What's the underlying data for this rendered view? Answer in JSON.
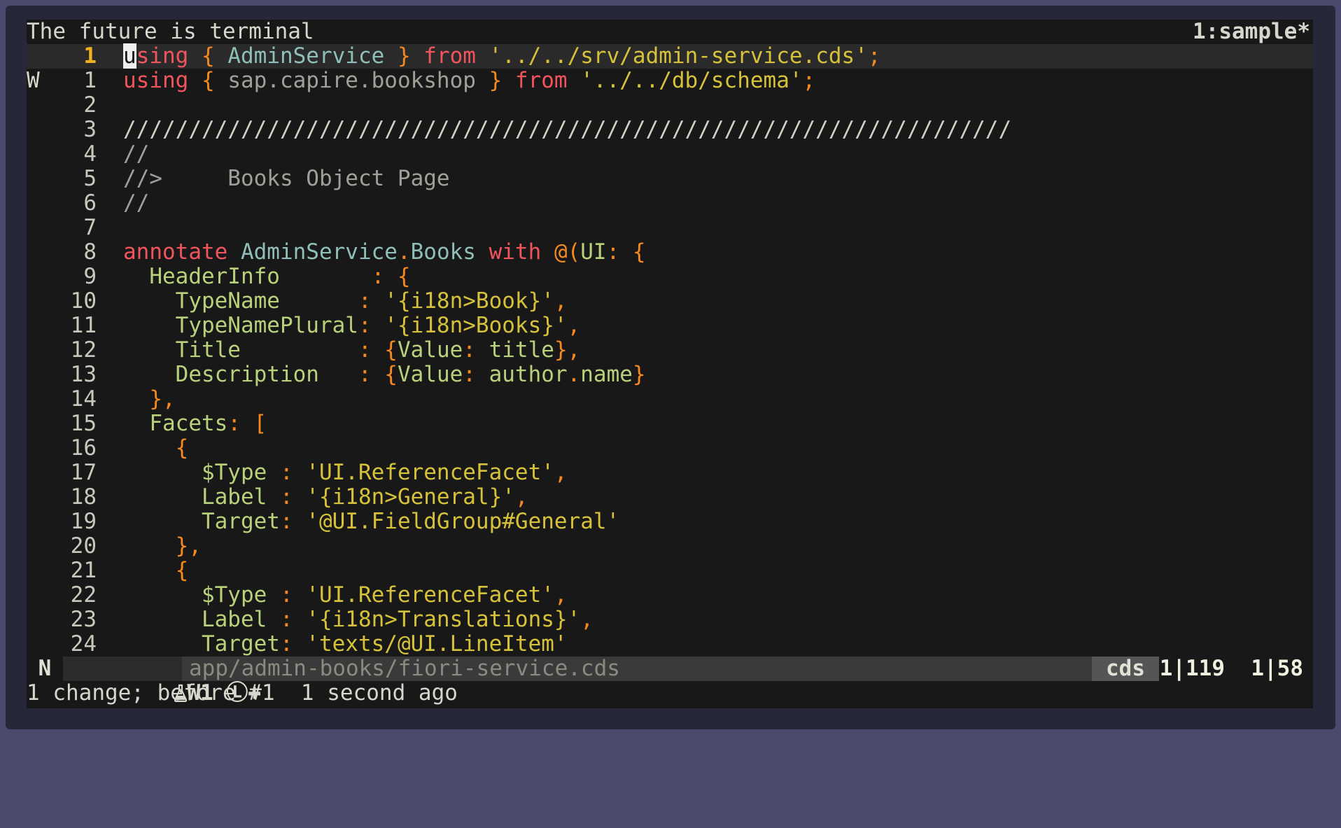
{
  "window": {
    "title": "The future is terminal",
    "session": "1:sample*"
  },
  "editor": {
    "lines": [
      {
        "mark": "",
        "num": "1",
        "current": true,
        "tokens": [
          [
            "cursor",
            "u"
          ],
          [
            "kw",
            "sing "
          ],
          [
            "pun",
            "{ "
          ],
          [
            "mod",
            "AdminService "
          ],
          [
            "pun",
            "} "
          ],
          [
            "kw",
            "from "
          ],
          [
            "str",
            "'../../srv/admin-service.cds'"
          ],
          [
            "pun",
            ";"
          ]
        ]
      },
      {
        "mark": "W",
        "num": "1",
        "tokens": [
          [
            "kw",
            "using "
          ],
          [
            "pun",
            "{ "
          ],
          [
            "cmt",
            "sap.capire.bookshop "
          ],
          [
            "pun",
            "} "
          ],
          [
            "kw",
            "from "
          ],
          [
            "str",
            "'../../db/schema'"
          ],
          [
            "pun",
            ";"
          ]
        ]
      },
      {
        "mark": "",
        "num": "2",
        "tokens": []
      },
      {
        "mark": "",
        "num": "3",
        "tokens": [
          [
            "plain",
            "////////////////////////////////////////////////////////////////////"
          ]
        ]
      },
      {
        "mark": "",
        "num": "4",
        "tokens": [
          [
            "cmt",
            "//"
          ]
        ]
      },
      {
        "mark": "",
        "num": "5",
        "tokens": [
          [
            "cmt",
            "//>     Books Object Page"
          ]
        ]
      },
      {
        "mark": "",
        "num": "6",
        "tokens": [
          [
            "cmt",
            "//"
          ]
        ]
      },
      {
        "mark": "",
        "num": "7",
        "tokens": []
      },
      {
        "mark": "",
        "num": "8",
        "tokens": [
          [
            "kw",
            "annotate "
          ],
          [
            "mod",
            "AdminService"
          ],
          [
            "pun",
            "."
          ],
          [
            "mod",
            "Books "
          ],
          [
            "kw",
            "with "
          ],
          [
            "pun",
            "@("
          ],
          [
            "prop",
            "UI"
          ],
          [
            "pun",
            ": {"
          ]
        ]
      },
      {
        "mark": "",
        "num": "9",
        "tokens": [
          [
            "plain",
            "  "
          ],
          [
            "prop",
            "HeaderInfo       "
          ],
          [
            "pun",
            ": {"
          ]
        ]
      },
      {
        "mark": "",
        "num": "10",
        "tokens": [
          [
            "plain",
            "    "
          ],
          [
            "prop",
            "TypeName      "
          ],
          [
            "pun",
            ": "
          ],
          [
            "str",
            "'{i18n>Book}'"
          ],
          [
            "pun",
            ","
          ]
        ]
      },
      {
        "mark": "",
        "num": "11",
        "tokens": [
          [
            "plain",
            "    "
          ],
          [
            "prop",
            "TypeNamePlural"
          ],
          [
            "pun",
            ": "
          ],
          [
            "str",
            "'{i18n>Books}'"
          ],
          [
            "pun",
            ","
          ]
        ]
      },
      {
        "mark": "",
        "num": "12",
        "tokens": [
          [
            "plain",
            "    "
          ],
          [
            "prop",
            "Title         "
          ],
          [
            "pun",
            ": {"
          ],
          [
            "prop",
            "Value"
          ],
          [
            "pun",
            ": "
          ],
          [
            "prop",
            "title"
          ],
          [
            "pun",
            "},"
          ]
        ]
      },
      {
        "mark": "",
        "num": "13",
        "tokens": [
          [
            "plain",
            "    "
          ],
          [
            "prop",
            "Description   "
          ],
          [
            "pun",
            ": {"
          ],
          [
            "prop",
            "Value"
          ],
          [
            "pun",
            ": "
          ],
          [
            "prop",
            "author"
          ],
          [
            "pun",
            "."
          ],
          [
            "prop",
            "name"
          ],
          [
            "pun",
            "}"
          ]
        ]
      },
      {
        "mark": "",
        "num": "14",
        "tokens": [
          [
            "plain",
            "  "
          ],
          [
            "pun",
            "},"
          ]
        ]
      },
      {
        "mark": "",
        "num": "15",
        "tokens": [
          [
            "plain",
            "  "
          ],
          [
            "prop",
            "Facets"
          ],
          [
            "pun",
            ": ["
          ]
        ]
      },
      {
        "mark": "",
        "num": "16",
        "tokens": [
          [
            "plain",
            "    "
          ],
          [
            "pun",
            "{"
          ]
        ]
      },
      {
        "mark": "",
        "num": "17",
        "tokens": [
          [
            "plain",
            "      "
          ],
          [
            "prop",
            "$Type "
          ],
          [
            "pun",
            ": "
          ],
          [
            "str",
            "'UI.ReferenceFacet'"
          ],
          [
            "pun",
            ","
          ]
        ]
      },
      {
        "mark": "",
        "num": "18",
        "tokens": [
          [
            "plain",
            "      "
          ],
          [
            "prop",
            "Label "
          ],
          [
            "pun",
            ": "
          ],
          [
            "str",
            "'{i18n>General}'"
          ],
          [
            "pun",
            ","
          ]
        ]
      },
      {
        "mark": "",
        "num": "19",
        "tokens": [
          [
            "plain",
            "      "
          ],
          [
            "prop",
            "Target"
          ],
          [
            "pun",
            ": "
          ],
          [
            "str",
            "'@UI.FieldGroup#General'"
          ]
        ]
      },
      {
        "mark": "",
        "num": "20",
        "tokens": [
          [
            "plain",
            "    "
          ],
          [
            "pun",
            "},"
          ]
        ]
      },
      {
        "mark": "",
        "num": "21",
        "tokens": [
          [
            "plain",
            "    "
          ],
          [
            "pun",
            "{"
          ]
        ]
      },
      {
        "mark": "",
        "num": "22",
        "tokens": [
          [
            "plain",
            "      "
          ],
          [
            "prop",
            "$Type "
          ],
          [
            "pun",
            ": "
          ],
          [
            "str",
            "'UI.ReferenceFacet'"
          ],
          [
            "pun",
            ","
          ]
        ]
      },
      {
        "mark": "",
        "num": "23",
        "tokens": [
          [
            "plain",
            "      "
          ],
          [
            "prop",
            "Label "
          ],
          [
            "pun",
            ": "
          ],
          [
            "str",
            "'{i18n>Translations}'"
          ],
          [
            "pun",
            ","
          ]
        ]
      },
      {
        "mark": "",
        "num": "24",
        "tokens": [
          [
            "plain",
            "      "
          ],
          [
            "prop",
            "Target"
          ],
          [
            "pun",
            ": "
          ],
          [
            "str",
            "'texts/@UI.LineItem'"
          ]
        ]
      }
    ]
  },
  "statusbar": {
    "mode": "N",
    "warnings": "W1",
    "flags": "Ⓛ+",
    "path": "app/admin-books/fiori-service.cds",
    "filetype": "cds",
    "position": "1|119",
    "column": "1|58"
  },
  "message": "1 change; before #1  1 second ago"
}
